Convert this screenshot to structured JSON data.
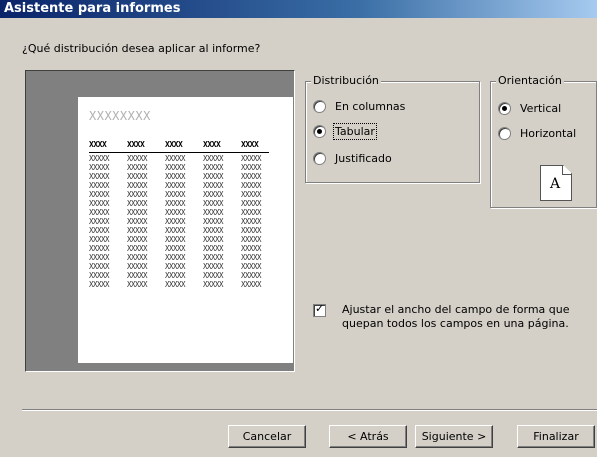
{
  "window": {
    "title": "Asistente para informes"
  },
  "question": "¿Qué distribución desea aplicar al informe?",
  "preview": {
    "title_placeholder": "XXXXXXXX",
    "header": [
      "XXXX",
      "XXXX",
      "XXXX",
      "XXXX",
      "XXXX"
    ],
    "row_text": "XXXXX"
  },
  "distribution": {
    "legend": "Distribución",
    "options": [
      {
        "label": "En columnas",
        "checked": false
      },
      {
        "label": "Tabular",
        "checked": true
      },
      {
        "label": "Justificado",
        "checked": false
      }
    ]
  },
  "orientation": {
    "legend": "Orientación",
    "options": [
      {
        "label": "Vertical",
        "checked": true
      },
      {
        "label": "Horizontal",
        "checked": false
      }
    ],
    "icon_letter": "A"
  },
  "adjust_checkbox": {
    "checked": true,
    "label": "Ajustar el ancho del campo de forma que quepan todos los campos en una página."
  },
  "buttons": {
    "cancel": "Cancelar",
    "back": "< Atrás",
    "next": "Siguiente >",
    "finish": "Finalizar"
  }
}
